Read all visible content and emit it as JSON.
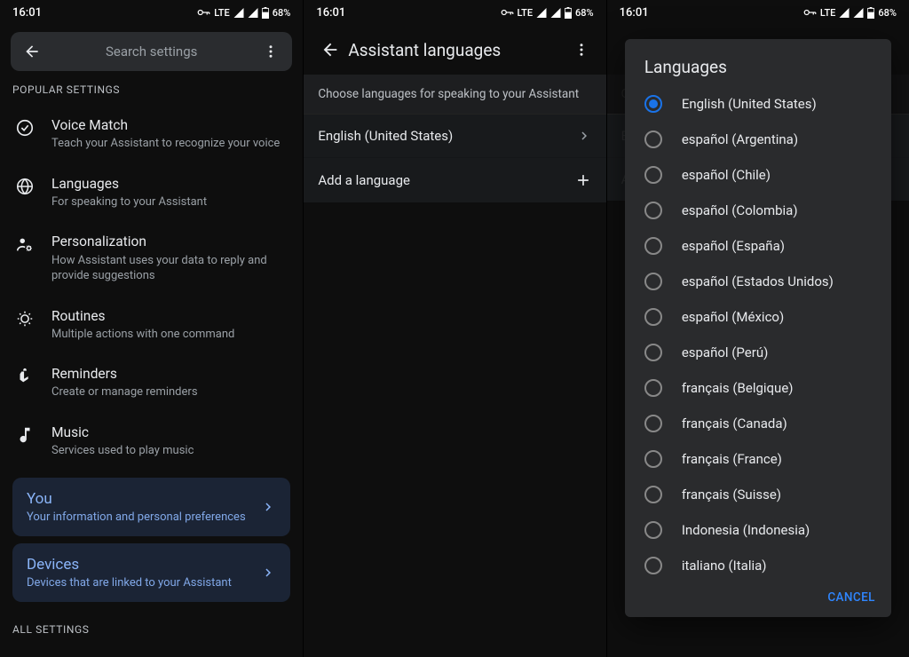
{
  "status": {
    "time": "16:01",
    "lte": "LTE",
    "battery": "68%"
  },
  "screen1": {
    "search_placeholder": "Search settings",
    "popular_label": "POPULAR SETTINGS",
    "all_label": "ALL SETTINGS",
    "items": [
      {
        "title": "Voice Match",
        "sub": "Teach your Assistant to recognize your voice"
      },
      {
        "title": "Languages",
        "sub": "For speaking to your Assistant"
      },
      {
        "title": "Personalization",
        "sub": "How Assistant uses your data to reply and provide suggestions"
      },
      {
        "title": "Routines",
        "sub": "Multiple actions with one command"
      },
      {
        "title": "Reminders",
        "sub": "Create or manage reminders"
      },
      {
        "title": "Music",
        "sub": "Services used to play music"
      }
    ],
    "cards": [
      {
        "title": "You",
        "sub": "Your information and personal preferences"
      },
      {
        "title": "Devices",
        "sub": "Devices that are linked to your Assistant"
      }
    ]
  },
  "screen2": {
    "title": "Assistant languages",
    "subtitle": "Choose languages for speaking to your Assistant",
    "current": "English (United States)",
    "add": "Add a language"
  },
  "dialog": {
    "title": "Languages",
    "cancel": "CANCEL",
    "selected_index": 0,
    "options": [
      "English (United States)",
      "español (Argentina)",
      "español (Chile)",
      "español (Colombia)",
      "español (España)",
      "español (Estados Unidos)",
      "español (México)",
      "español (Perú)",
      "français (Belgique)",
      "français (Canada)",
      "français (France)",
      "français (Suisse)",
      "Indonesia (Indonesia)",
      "italiano (Italia)"
    ]
  }
}
